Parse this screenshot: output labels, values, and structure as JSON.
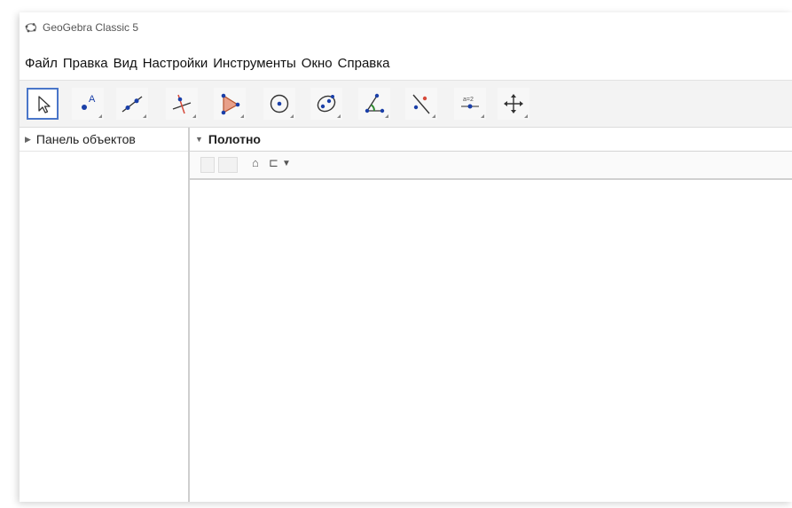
{
  "window": {
    "title": "GeoGebra Classic 5"
  },
  "menubar": {
    "items": [
      "Файл",
      "Правка",
      "Вид",
      "Настройки",
      "Инструменты",
      "Окно",
      "Справка"
    ]
  },
  "toolbar": {
    "tools": [
      {
        "icon": "move-pointer-icon",
        "selected": true
      },
      {
        "icon": "point-icon",
        "selected": false
      },
      {
        "icon": "line-icon",
        "selected": false
      },
      {
        "icon": "perpendicular-line-icon",
        "selected": false
      },
      {
        "icon": "polygon-icon",
        "selected": false
      },
      {
        "icon": "circle-center-icon",
        "selected": false
      },
      {
        "icon": "ellipse-icon",
        "selected": false
      },
      {
        "icon": "angle-icon",
        "selected": false
      },
      {
        "icon": "reflect-icon",
        "selected": false
      },
      {
        "icon": "slider-icon",
        "selected": false
      },
      {
        "icon": "move-graphics-icon",
        "selected": false
      }
    ]
  },
  "algebra_panel": {
    "title": "Панель объектов"
  },
  "graphics_panel": {
    "title": "Полотно",
    "style_bar_icons": [
      "home-icon",
      "graphics-view-icon",
      "dropdown-icon"
    ]
  },
  "colors": {
    "accent": "#4a76c9",
    "point": "#1a3fa8",
    "polygon_fill": "#e8a08a",
    "red": "#d64a3a"
  }
}
